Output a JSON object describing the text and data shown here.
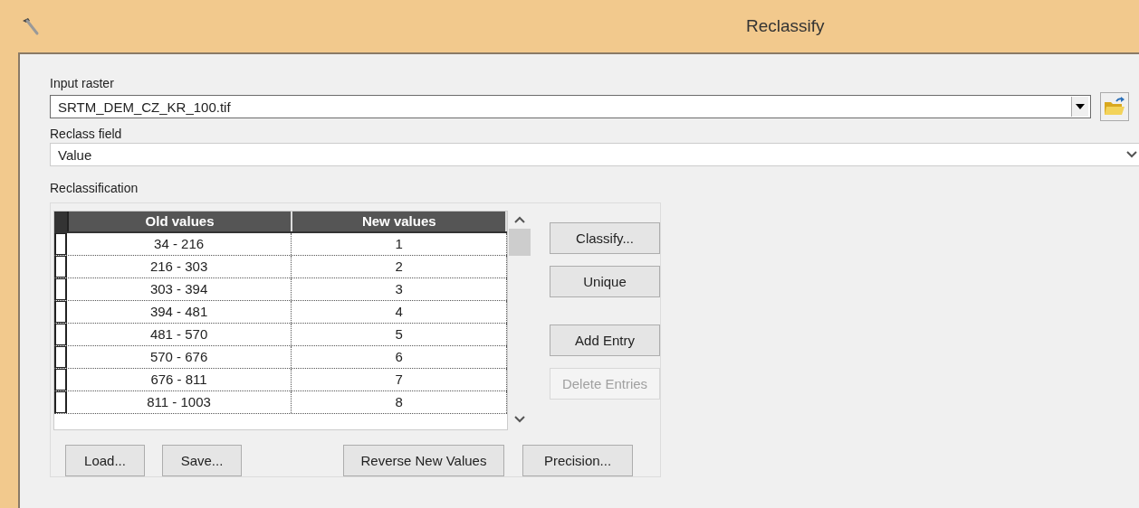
{
  "window": {
    "title": "Reclassify"
  },
  "input_raster": {
    "label": "Input raster",
    "value": "SRTM_DEM_CZ_KR_100.tif"
  },
  "reclass_field": {
    "label": "Reclass field",
    "value": "Value"
  },
  "reclassification": {
    "label": "Reclassification",
    "table": {
      "columns": [
        "Old values",
        "New values"
      ],
      "rows": [
        {
          "old": "34 - 216",
          "new": "1"
        },
        {
          "old": "216 - 303",
          "new": "2"
        },
        {
          "old": "303 - 394",
          "new": "3"
        },
        {
          "old": "394 - 481",
          "new": "4"
        },
        {
          "old": "481 - 570",
          "new": "5"
        },
        {
          "old": "570 - 676",
          "new": "6"
        },
        {
          "old": "676 - 811",
          "new": "7"
        },
        {
          "old": "811 - 1003",
          "new": "8"
        }
      ]
    },
    "side_buttons": [
      {
        "label": "Classify...",
        "disabled": false
      },
      {
        "label": "Unique",
        "disabled": false
      },
      {
        "label": "Add Entry",
        "disabled": false
      },
      {
        "label": "Delete Entries",
        "disabled": true
      }
    ],
    "bottom_buttons": [
      {
        "label": "Load..."
      },
      {
        "label": "Save..."
      },
      {
        "label": "Reverse New Values"
      },
      {
        "label": "Precision..."
      }
    ]
  }
}
